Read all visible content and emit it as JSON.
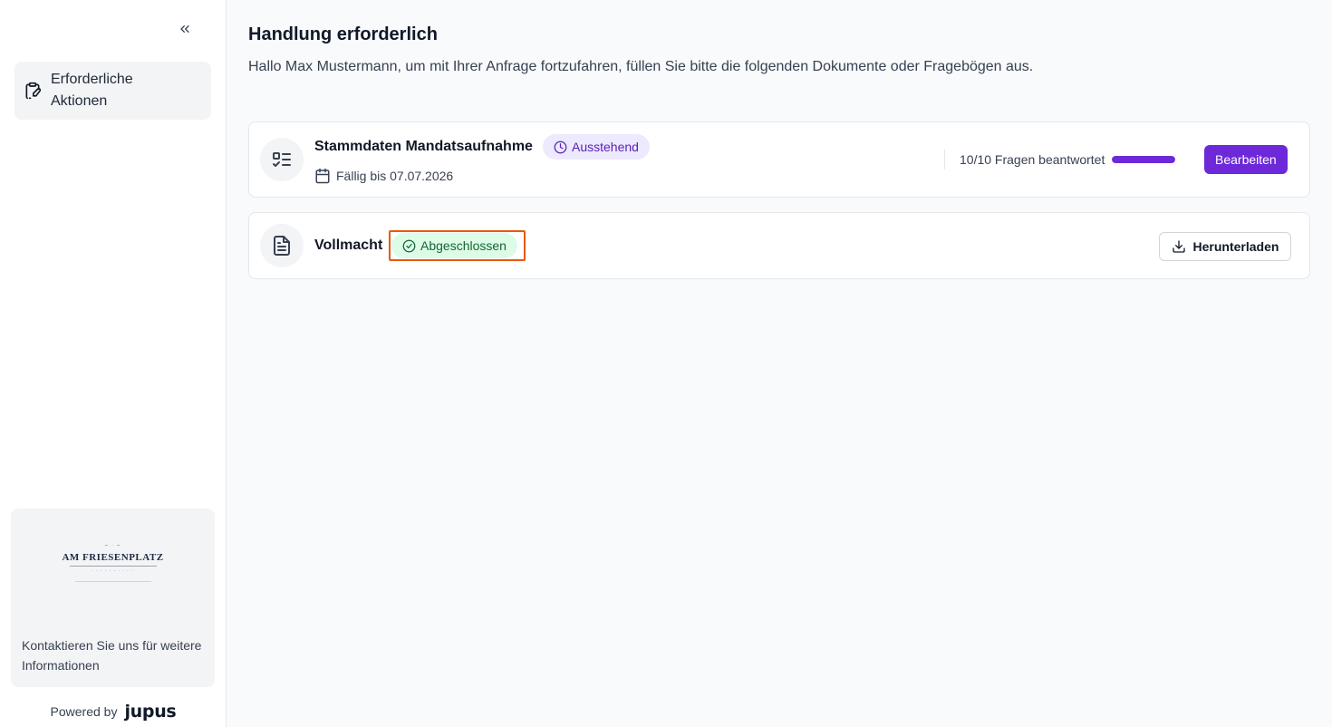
{
  "sidebar": {
    "nav_items": [
      {
        "label": "Erforderliche Aktionen",
        "icon": "clipboard-pen-icon"
      }
    ],
    "firm": {
      "logo_name": "AM FRIESENPLATZ",
      "contact_text": "Kontaktieren Sie uns für weitere Informationen"
    },
    "powered_by": "Powered by",
    "brand": "jupus"
  },
  "main": {
    "title": "Handlung erforderlich",
    "subtitle": "Hallo Max Mustermann, um mit Ihrer Anfrage fortzufahren, füllen Sie bitte die folgenden Dokumente oder Fragebögen aus.",
    "items": [
      {
        "title": "Stammdaten Mandatsaufnahme",
        "icon": "checklist-icon",
        "status": "Ausstehend",
        "status_color": "#5b21b6",
        "due": "Fällig bis 07.07.2026",
        "progress_text": "10/10 Fragen beantwortet",
        "progress_fraction": 1.0,
        "action_label": "Bearbeiten"
      },
      {
        "title": "Vollmacht",
        "icon": "document-icon",
        "status": "Abgeschlossen",
        "status_color": "#166534",
        "action_label": "Herunterladen"
      }
    ]
  },
  "colors": {
    "accent": "#6d28d9",
    "highlight": "#ea580c"
  }
}
